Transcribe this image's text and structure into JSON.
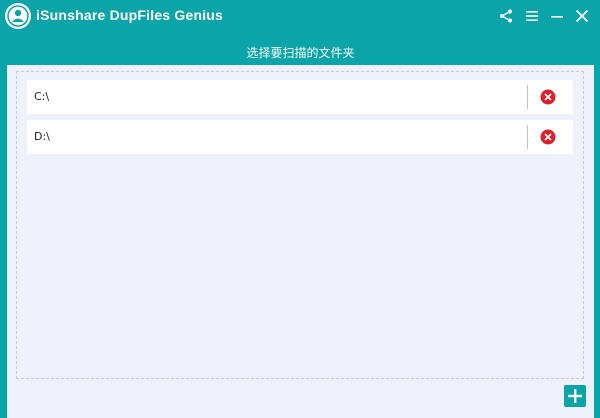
{
  "window": {
    "title": "iSunshare DupFiles Genius",
    "controls": {
      "share": "share-icon",
      "menu": "hamburger-menu-icon",
      "minimize": "minimize-icon",
      "close": "close-icon"
    }
  },
  "section": {
    "header": "选择要扫描的文件夹"
  },
  "folders": [
    {
      "path": "C:\\"
    },
    {
      "path": "D:\\"
    }
  ],
  "colors": {
    "accent": "#0ba4a8",
    "panel_bg": "#eef0fb",
    "remove_red": "#d9212b"
  },
  "actions": {
    "add_icon": "plus-icon",
    "remove_icon": "remove-circle-icon"
  }
}
